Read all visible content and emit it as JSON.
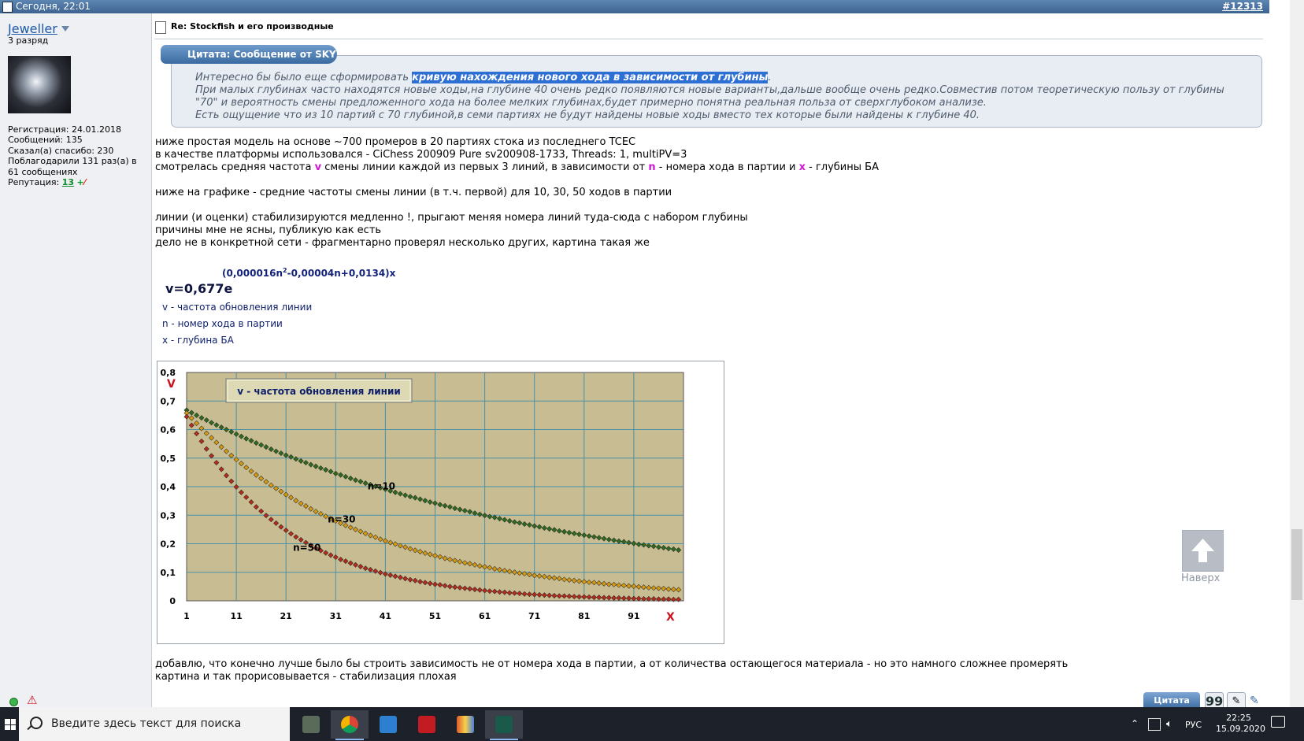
{
  "post": {
    "date": "Сегодня, 22:01",
    "number": "#12313",
    "title": "Re: Stockfish и его производные"
  },
  "user": {
    "name": "Jeweller",
    "rank": "3 разряд",
    "info": [
      "Регистрация: 24.01.2018",
      "Сообщений: 135",
      "Сказал(а) спасибо: 230",
      "Поблагодарили 131 раз(а) в",
      "61 сообщениях"
    ],
    "reputation_label": "Репутация:",
    "reputation_value": "13"
  },
  "quote": {
    "header": "Цитата: Сообщение от SKY",
    "line1_pre": "Интересно бы было еще сформировать ",
    "line1_hl": "кривую нахождения нового хода в зависимости от глубины",
    "line1_post": ".",
    "line2": "При малых глубинах часто находятся новые ходы,на глубине 40 очень редко появляются новые варианты,дальше вообще очень редко.Совместив потом теоретическую пользу от глубины",
    "line3": "\"70\" и вероятность смены предложенного хода на более мелких глубинах,будет примерно понятна реальная польза от сверхглубоком анализе.",
    "line4": "Есть ощущение что из 10 партий с 70 глубиной,в семи партиях не будут найдены новые ходы вместо тех которые были найдены к глубине 40."
  },
  "body": {
    "l1": "ниже простая модель на основе ~700 промеров в 20 партиях стока из последнего TCEC",
    "l2": "в качестве платформы использовался - CiChess 200909 Pure sv200908-1733, Threads: 1, multiPV=3",
    "l3a": "смотрелась средняя частота ",
    "l3v": "v",
    "l3b": " смены линии каждой из первых 3 линий, в зависимости от ",
    "l3n": "n",
    "l3c": " - номера хода в партии и ",
    "l3x": "x",
    "l3d": " - глубины БА",
    "l4": "ниже на графике - средние частоты смены линии (в т.ч. первой) для 10, 30, 50 ходов в партии",
    "l5": "линии (и оценки) стабилизируются медленно !, прыгают меняя номера линий туда-сюда с набором глубины",
    "l6": "причины мне не ясны, публикую как есть",
    "l7": "дело не в конкретной сети - фрагментарно проверял несколько других, картина такая же",
    "l8": "добавлю, что конечно лучше было бы строить зависимость не от номера хода в партии, а от количества остающегося материала - но это намного сложнее промерять",
    "l9": "картина и так прорисовывается - стабилизация плохая"
  },
  "formula": {
    "main": "v=0,677e",
    "exponent_pre": "(0,000016n",
    "exponent_sup": "2",
    "exponent_post": "-0,00004n+0,0134)x",
    "legend": [
      "v - частота обновления линии",
      "n - номер хода в партии",
      "x - глубина БА"
    ]
  },
  "chart_data": {
    "type": "scatter",
    "title": "v - частота обновления линии",
    "ylabel": "V",
    "xlabel": "X",
    "formula": "v = 0.677·exp(-(0.000016n² - 0.00004n + 0.0134)·x)",
    "ylim": [
      0,
      0.8
    ],
    "xlim": [
      1,
      101
    ],
    "x_ticks": [
      "1",
      "11",
      "21",
      "31",
      "41",
      "51",
      "61",
      "71",
      "81",
      "91"
    ],
    "y_ticks": [
      "0",
      "0,1",
      "0,2",
      "0,3",
      "0,4",
      "0,5",
      "0,6",
      "0,7",
      "0,8"
    ],
    "grid": true,
    "x": [
      1,
      2,
      3,
      4,
      5,
      6,
      7,
      8,
      9,
      10,
      11,
      12,
      13,
      14,
      15,
      16,
      17,
      18,
      19,
      20,
      21,
      22,
      23,
      24,
      25,
      26,
      27,
      28,
      29,
      30,
      31,
      32,
      33,
      34,
      35,
      36,
      37,
      38,
      39,
      40,
      41,
      42,
      43,
      44,
      45,
      46,
      47,
      48,
      49,
      50,
      51,
      52,
      53,
      54,
      55,
      56,
      57,
      58,
      59,
      60,
      61,
      62,
      63,
      64,
      65,
      66,
      67,
      68,
      69,
      70,
      71,
      72,
      73,
      74,
      75,
      76,
      77,
      78,
      79,
      80,
      81,
      82,
      83,
      84,
      85,
      86,
      87,
      88,
      89,
      90,
      91,
      92,
      93,
      94,
      95,
      96,
      97,
      98,
      99,
      100
    ],
    "series": [
      {
        "name": "n=10",
        "color": "#2e6b1e",
        "values": [
          0.668,
          0.659,
          0.65,
          0.641,
          0.633,
          0.624,
          0.616,
          0.608,
          0.6,
          0.592,
          0.584,
          0.576,
          0.568,
          0.561,
          0.553,
          0.546,
          0.539,
          0.531,
          0.524,
          0.517,
          0.51,
          0.504,
          0.497,
          0.49,
          0.484,
          0.477,
          0.471,
          0.465,
          0.459,
          0.453,
          0.446,
          0.441,
          0.435,
          0.429,
          0.423,
          0.418,
          0.412,
          0.407,
          0.401,
          0.396,
          0.391,
          0.385,
          0.38,
          0.375,
          0.37,
          0.365,
          0.361,
          0.356,
          0.351,
          0.346,
          0.342,
          0.337,
          0.333,
          0.329,
          0.324,
          0.32,
          0.316,
          0.312,
          0.307,
          0.303,
          0.299,
          0.295,
          0.292,
          0.288,
          0.284,
          0.28,
          0.276,
          0.273,
          0.269,
          0.266,
          0.262,
          0.259,
          0.255,
          0.252,
          0.249,
          0.245,
          0.242,
          0.239,
          0.236,
          0.233,
          0.23,
          0.227,
          0.224,
          0.221,
          0.218,
          0.215,
          0.212,
          0.209,
          0.207,
          0.204,
          0.201,
          0.198,
          0.196,
          0.193,
          0.191,
          0.188,
          0.186,
          0.183,
          0.181,
          0.178
        ]
      },
      {
        "name": "n=30",
        "color": "#d69a12",
        "values": [
          0.658,
          0.64,
          0.622,
          0.604,
          0.587,
          0.571,
          0.555,
          0.539,
          0.524,
          0.509,
          0.495,
          0.481,
          0.467,
          0.454,
          0.441,
          0.429,
          0.417,
          0.405,
          0.394,
          0.383,
          0.372,
          0.362,
          0.351,
          0.341,
          0.332,
          0.322,
          0.313,
          0.305,
          0.296,
          0.288,
          0.28,
          0.272,
          0.264,
          0.257,
          0.25,
          0.243,
          0.236,
          0.229,
          0.223,
          0.216,
          0.21,
          0.204,
          0.199,
          0.193,
          0.188,
          0.182,
          0.177,
          0.172,
          0.167,
          0.163,
          0.158,
          0.154,
          0.149,
          0.145,
          0.141,
          0.137,
          0.133,
          0.13,
          0.126,
          0.122,
          0.119,
          0.116,
          0.112,
          0.109,
          0.106,
          0.103,
          0.1,
          0.097,
          0.095,
          0.092,
          0.089,
          0.087,
          0.085,
          0.082,
          0.08,
          0.078,
          0.075,
          0.073,
          0.071,
          0.069,
          0.067,
          0.065,
          0.064,
          0.062,
          0.06,
          0.058,
          0.057,
          0.055,
          0.054,
          0.052,
          0.051,
          0.049,
          0.048,
          0.046,
          0.045,
          0.044,
          0.043,
          0.041,
          0.04,
          0.039
        ]
      },
      {
        "name": "n=50",
        "color": "#b52b1c",
        "values": [
          0.645,
          0.615,
          0.586,
          0.559,
          0.532,
          0.508,
          0.484,
          0.461,
          0.439,
          0.419,
          0.399,
          0.38,
          0.363,
          0.346,
          0.329,
          0.314,
          0.299,
          0.285,
          0.272,
          0.259,
          0.247,
          0.235,
          0.224,
          0.214,
          0.204,
          0.194,
          0.185,
          0.176,
          0.168,
          0.16,
          0.153,
          0.145,
          0.139,
          0.132,
          0.126,
          0.12,
          0.114,
          0.109,
          0.104,
          0.099,
          0.094,
          0.09,
          0.086,
          0.082,
          0.078,
          0.074,
          0.071,
          0.067,
          0.064,
          0.061,
          0.058,
          0.056,
          0.053,
          0.05,
          0.048,
          0.046,
          0.044,
          0.042,
          0.04,
          0.038,
          0.036,
          0.034,
          0.033,
          0.031,
          0.03,
          0.028,
          0.027,
          0.026,
          0.024,
          0.023,
          0.022,
          0.021,
          0.02,
          0.019,
          0.018,
          0.017,
          0.017,
          0.016,
          0.015,
          0.014,
          0.014,
          0.013,
          0.012,
          0.012,
          0.011,
          0.011,
          0.01,
          0.01,
          0.009,
          0.009,
          0.008,
          0.008,
          0.007,
          0.007,
          0.007,
          0.006,
          0.006,
          0.006,
          0.005,
          0.005
        ]
      }
    ],
    "annotations": [
      "n=10",
      "n=30",
      "n=50"
    ]
  },
  "buttons": {
    "to_top": "Наверх",
    "quote": "Цитата",
    "multi_quote": "99",
    "reply": "✎"
  },
  "taskbar": {
    "search_placeholder": "Введите здесь текст для поиска",
    "apps": [
      "calculator",
      "chrome",
      "mail",
      "app-red",
      "books",
      "chess"
    ],
    "lang": "РУС",
    "time": "22:25",
    "date": "15.09.2020"
  }
}
